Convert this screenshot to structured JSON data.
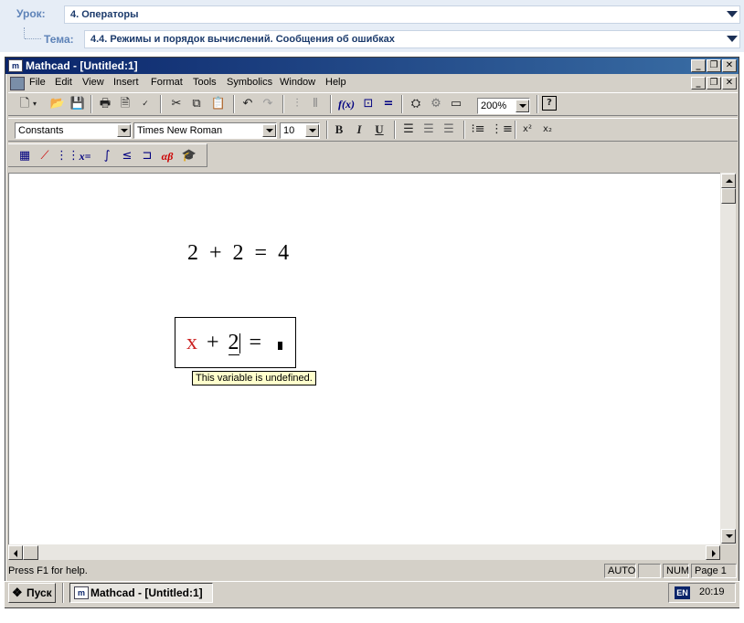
{
  "lesson": {
    "lesson_label": "Урок:",
    "lesson_value": "4. Операторы",
    "topic_label": "Тема:",
    "topic_value": "4.4. Режимы и порядок вычислений. Сообщения об ошибках"
  },
  "window": {
    "title": "Mathcad - [Untitled:1]",
    "app_icon_letter": "m"
  },
  "menu": [
    "File",
    "Edit",
    "View",
    "Insert",
    "Format",
    "Tools",
    "Symbolics",
    "Window",
    "Help"
  ],
  "toolbar": {
    "zoom_value": "200%",
    "help_glyph": "?"
  },
  "format_bar": {
    "style_value": "Constants",
    "font_value": "Times New Roman",
    "size_value": "10",
    "bold": "B",
    "italic": "I",
    "underline": "U"
  },
  "math_bar": {
    "eval_label": "x=",
    "greek_label": "αβ"
  },
  "worksheet": {
    "eq1": {
      "a": "2",
      "op": "+",
      "b": "2",
      "eq": "=",
      "result": "4"
    },
    "eq2": {
      "var": "x",
      "op": "+",
      "b": "2",
      "eq": "="
    },
    "error_tooltip": "This variable is undefined.",
    "error_color": "#cc2222"
  },
  "status": {
    "help_text": "Press F1 for help.",
    "mode": "AUTO",
    "num": "NUM",
    "page": "Page 1"
  },
  "taskbar": {
    "start_label": "Пуск",
    "task_label": "Mathcad - [Untitled:1]",
    "lang": "EN",
    "clock": "20:19"
  }
}
